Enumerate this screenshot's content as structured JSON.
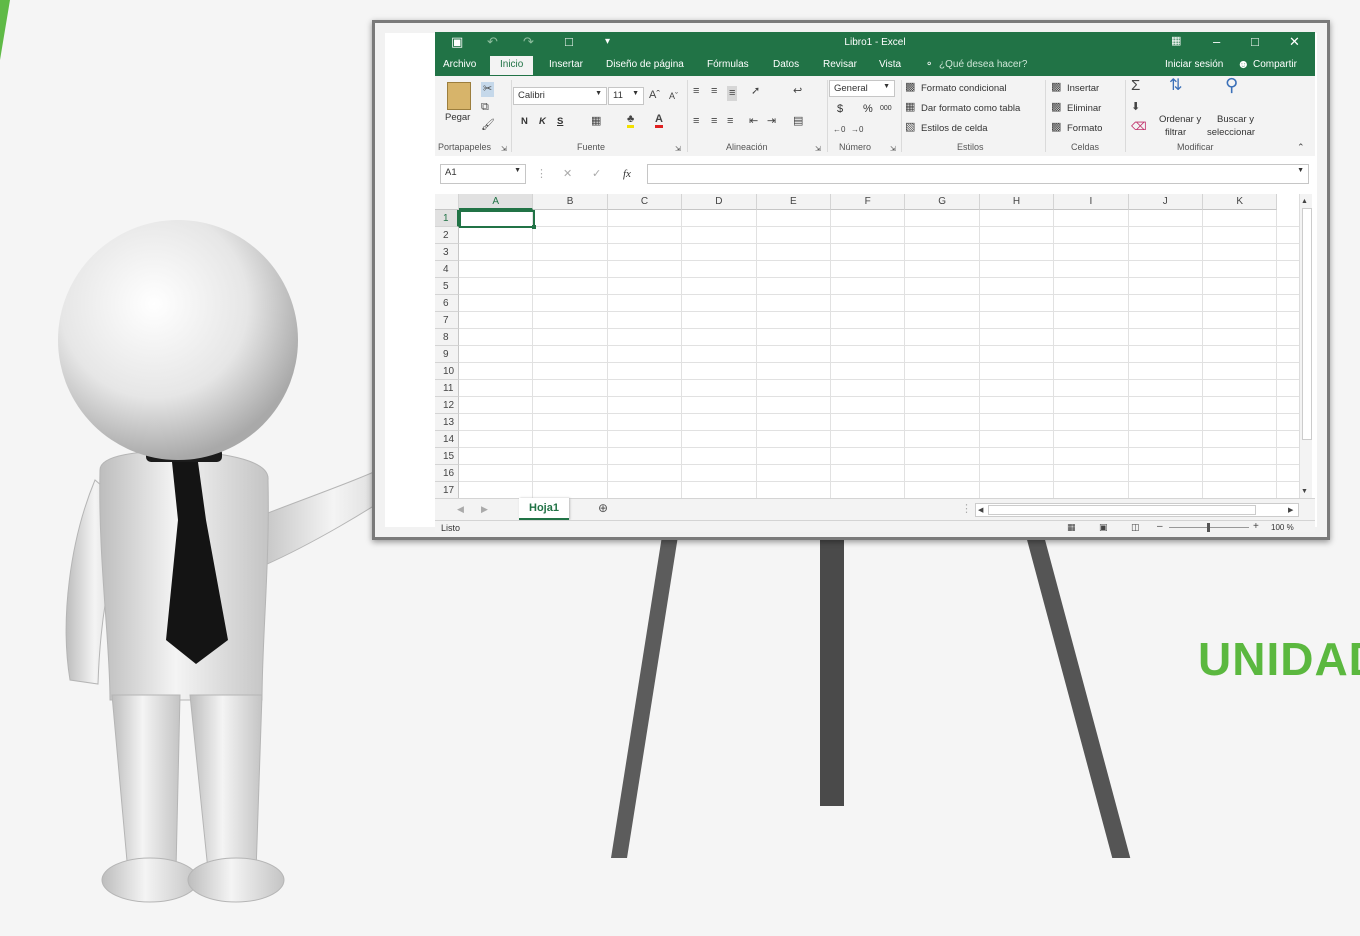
{
  "slide": {
    "unit_title": "UNIDAD"
  },
  "excel": {
    "window_title": "Libro1 - Excel",
    "tabs": [
      "Archivo",
      "Inicio",
      "Insertar",
      "Diseño de página",
      "Fórmulas",
      "Datos",
      "Revisar",
      "Vista"
    ],
    "active_tab": "Inicio",
    "tell_me": "¿Qué desea hacer?",
    "sign_in": "Iniciar sesión",
    "share": "Compartir",
    "groups": {
      "clipboard": {
        "label": "Portapapeles",
        "paste": "Pegar"
      },
      "font": {
        "label": "Fuente",
        "font_name": "Calibri",
        "font_size": "11",
        "bold": "N",
        "italic": "K",
        "underline": "S"
      },
      "alignment": {
        "label": "Alineación"
      },
      "number": {
        "label": "Número",
        "format": "General",
        "currency": "$",
        "percent": "%",
        "thousands": "000"
      },
      "styles": {
        "label": "Estilos",
        "conditional": "Formato condicional",
        "as_table": "Dar formato como tabla",
        "cell_styles": "Estilos de celda"
      },
      "cells": {
        "label": "Celdas",
        "insert": "Insertar",
        "delete": "Eliminar",
        "format": "Formato"
      },
      "editing": {
        "label": "Modificar",
        "sort_1": "Ordenar y",
        "sort_2": "filtrar",
        "find_1": "Buscar y",
        "find_2": "seleccionar"
      }
    },
    "name_box": "A1",
    "fx": "fx",
    "columns": [
      "A",
      "B",
      "C",
      "D",
      "E",
      "F",
      "G",
      "H",
      "I",
      "J",
      "K"
    ],
    "rows": [
      "1",
      "2",
      "3",
      "4",
      "5",
      "6",
      "7",
      "8",
      "9",
      "10",
      "11",
      "12",
      "13",
      "14",
      "15",
      "16",
      "17"
    ],
    "sheet_tab": "Hoja1",
    "status": "Listo",
    "zoom": "100 %"
  }
}
